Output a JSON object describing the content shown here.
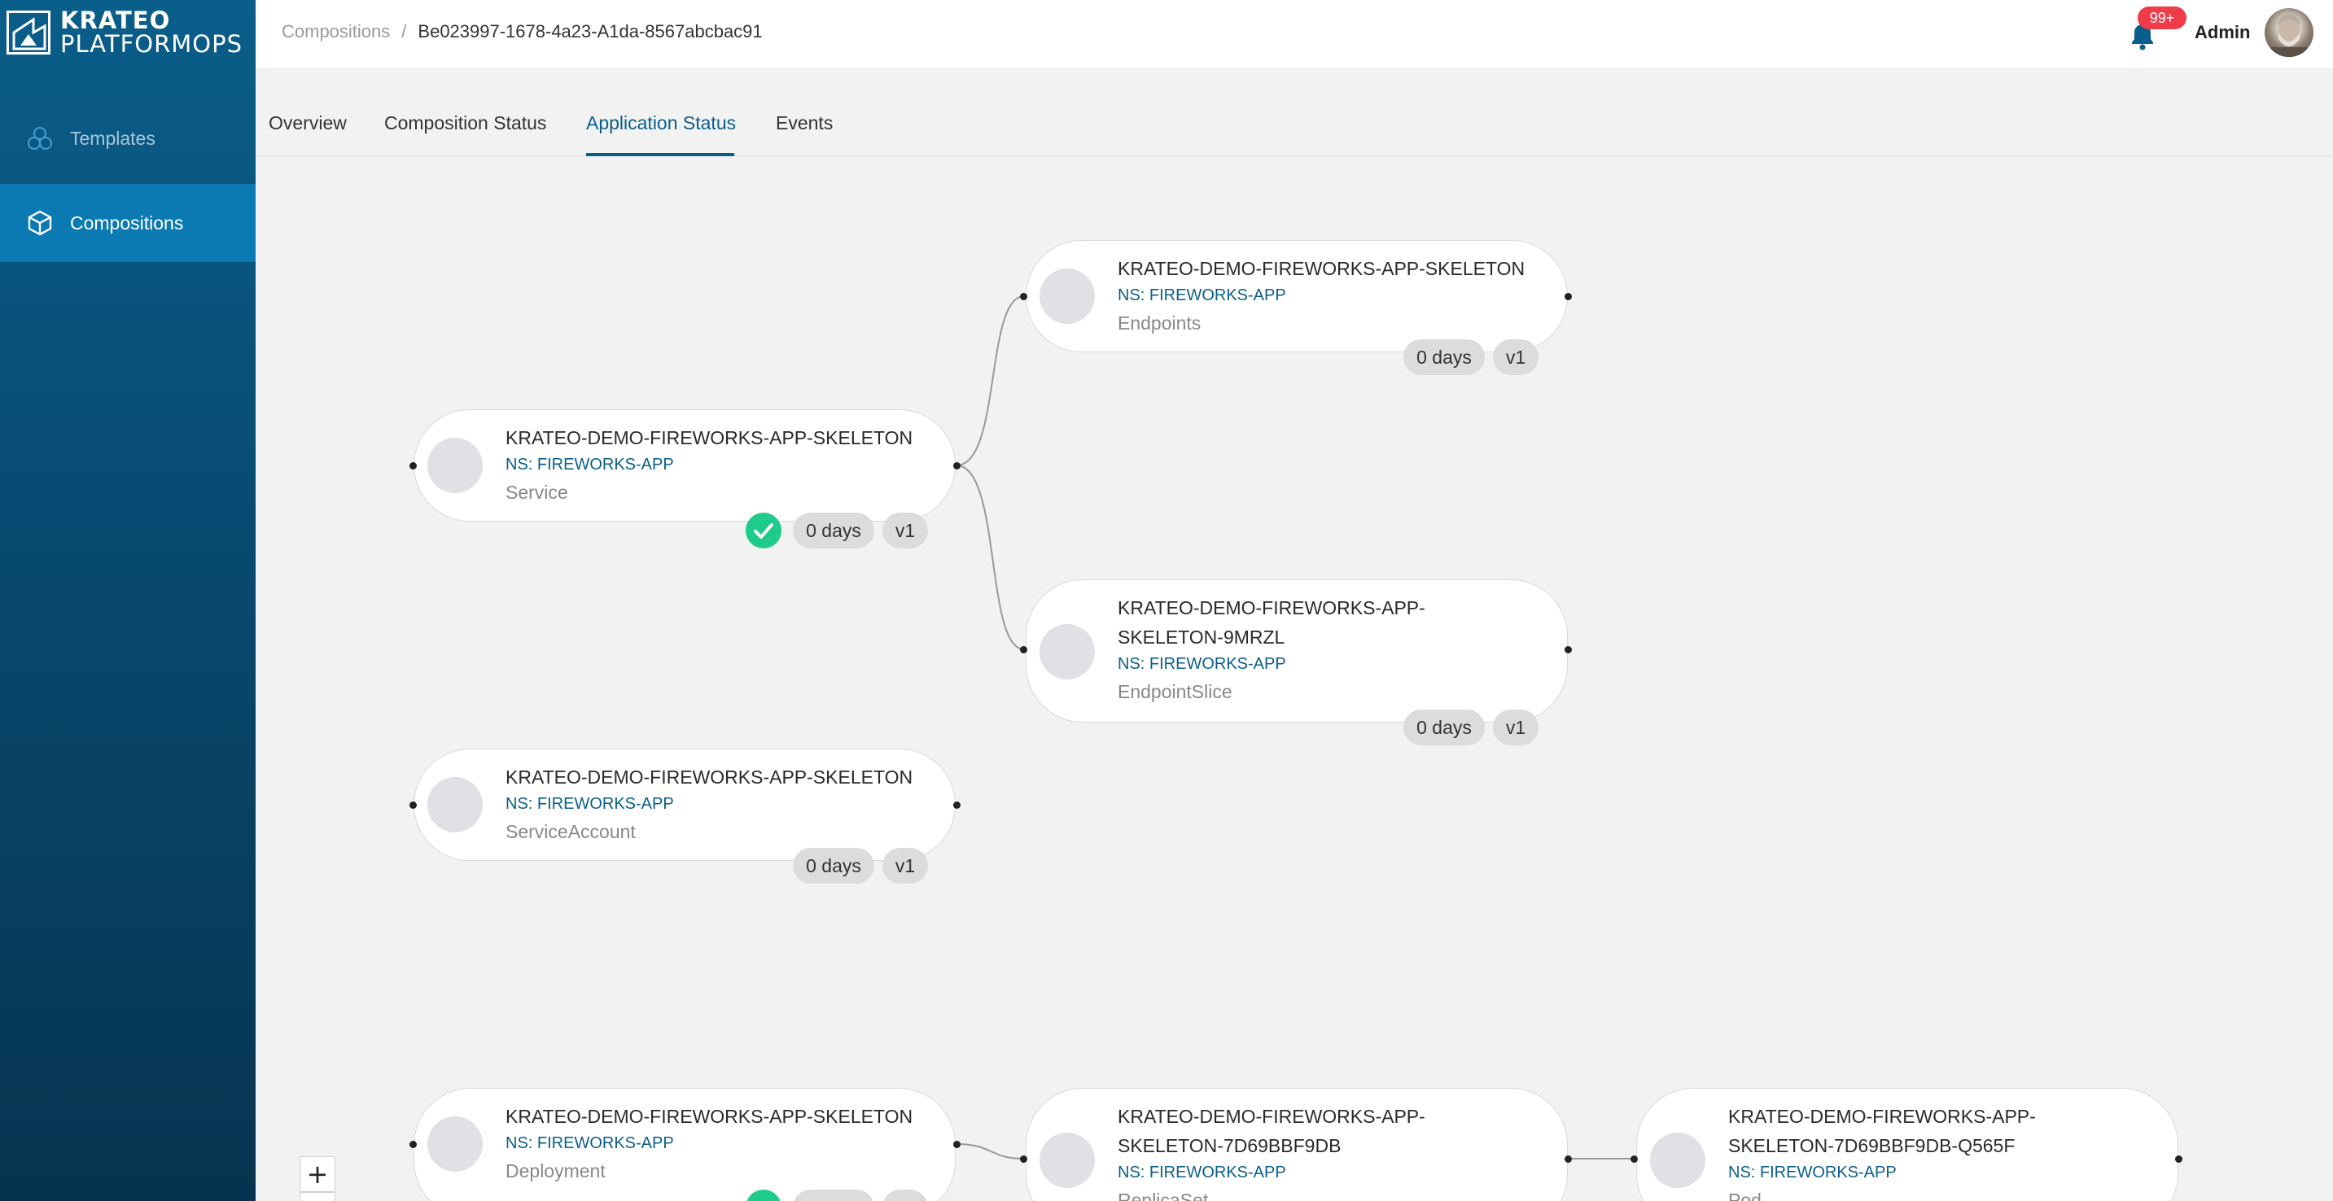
{
  "brand": {
    "line1": "KRATEO",
    "line2": "PLATFORMOPS"
  },
  "sidebar": {
    "items": [
      {
        "label": "Templates",
        "icon": "templates-icon",
        "active": false
      },
      {
        "label": "Compositions",
        "icon": "cube-icon",
        "active": true
      }
    ]
  },
  "header": {
    "breadcrumb_root": "Compositions",
    "breadcrumb_separator": "/",
    "breadcrumb_current": "Be023997-1678-4a23-A1da-8567abcbac91",
    "notifications_badge": "99+",
    "user_name": "Admin"
  },
  "tabs": [
    {
      "label": "Overview"
    },
    {
      "label": "Composition Status"
    },
    {
      "label": "Application Status",
      "active": true
    },
    {
      "label": "Events"
    }
  ],
  "colors": {
    "accent": "#0a5e8a",
    "sidebar_active": "#0b7ab3",
    "healthy": "#1fcb8c",
    "badge": "#ef3b4a"
  },
  "nodes": {
    "service": {
      "name": "KRATEO-DEMO-FIREWORKS-APP-SKELETON",
      "ns": "NS: FIREWORKS-APP",
      "kind": "Service",
      "age": "0 days",
      "version": "v1",
      "healthy": true
    },
    "endpoints": {
      "name": "KRATEO-DEMO-FIREWORKS-APP-SKELETON",
      "ns": "NS: FIREWORKS-APP",
      "kind": "Endpoints",
      "age": "0 days",
      "version": "v1"
    },
    "endpointslice": {
      "name": "KRATEO-DEMO-FIREWORKS-APP-SKELETON-9MRZL",
      "ns": "NS: FIREWORKS-APP",
      "kind": "EndpointSlice",
      "age": "0 days",
      "version": "v1"
    },
    "serviceaccount": {
      "name": "KRATEO-DEMO-FIREWORKS-APP-SKELETON",
      "ns": "NS: FIREWORKS-APP",
      "kind": "ServiceAccount",
      "age": "0 days",
      "version": "v1"
    },
    "deployment": {
      "name": "KRATEO-DEMO-FIREWORKS-APP-SKELETON",
      "ns": "NS: FIREWORKS-APP",
      "kind": "Deployment",
      "healthy": true
    },
    "replicaset": {
      "name": "KRATEO-DEMO-FIREWORKS-APP-SKELETON-7D69BBF9DB",
      "ns": "NS: FIREWORKS-APP",
      "kind": "ReplicaSet"
    },
    "pod": {
      "name": "KRATEO-DEMO-FIREWORKS-APP-SKELETON-7D69BBF9DB-Q565F",
      "ns": "NS: FIREWORKS-APP",
      "kind": "Pod"
    }
  },
  "zoom": {
    "plus_label": "+"
  }
}
